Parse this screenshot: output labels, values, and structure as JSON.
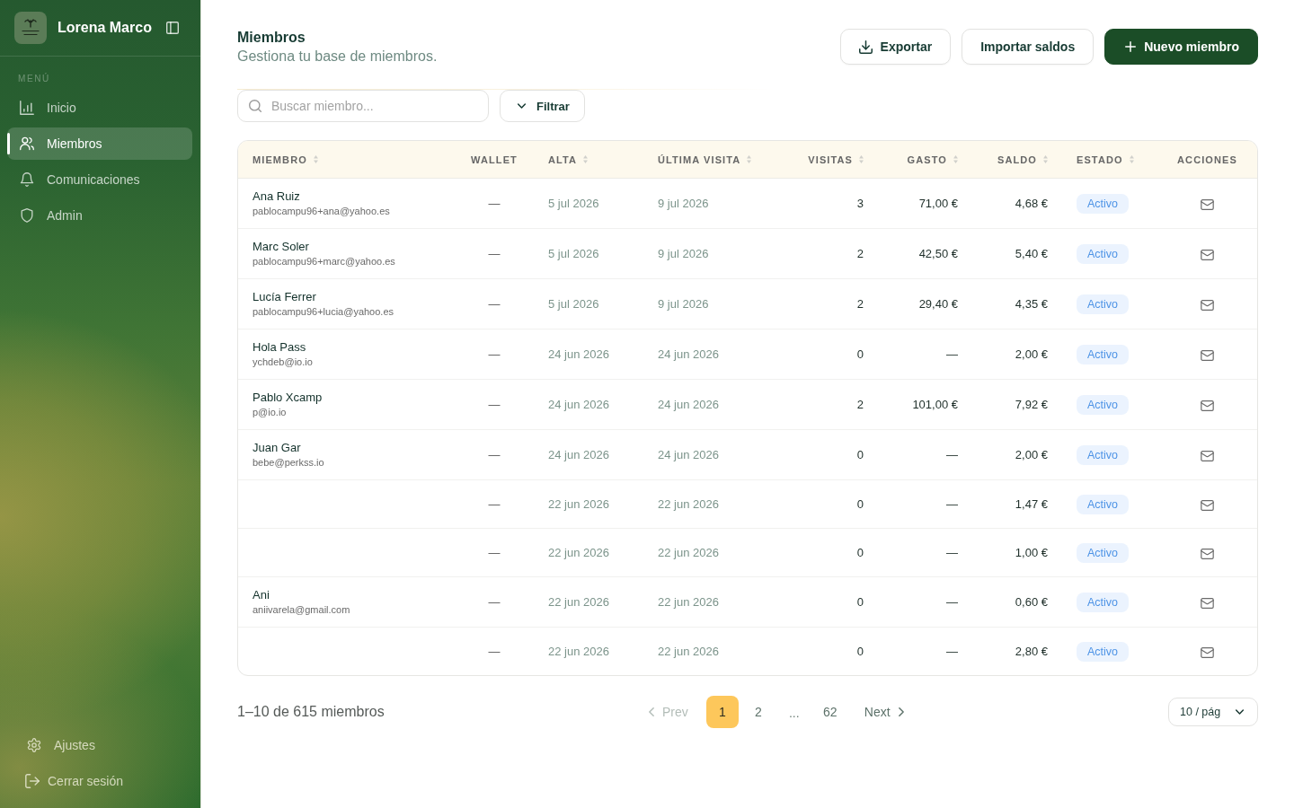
{
  "sidebar": {
    "brand": "Lorena Marco",
    "section_label": "MENÚ",
    "items": [
      {
        "label": "Inicio",
        "selected": false
      },
      {
        "label": "Miembros",
        "selected": true
      },
      {
        "label": "Comunicaciones",
        "selected": false
      },
      {
        "label": "Admin",
        "selected": false
      }
    ],
    "footer_items": [
      {
        "label": "Ajustes"
      },
      {
        "label": "Cerrar sesión"
      }
    ]
  },
  "header": {
    "title": "Miembros",
    "subtitle": "Gestiona tu base de miembros.",
    "buttons": [
      {
        "label": "Exportar",
        "kind": "export"
      },
      {
        "label": "Importar saldos",
        "kind": "plain"
      },
      {
        "label": "Nuevo miembro",
        "kind": "primary"
      }
    ]
  },
  "toolbar": {
    "search": {
      "placeholder": "Buscar miembro..."
    },
    "filter": {
      "label": "Filtrar"
    }
  },
  "table": {
    "columns": [
      {
        "label": "MIEMBRO",
        "sortable": true
      },
      {
        "label": "WALLET",
        "sortable": false
      },
      {
        "label": "ALTA",
        "sortable": true
      },
      {
        "label": "ÚLTIMA VISITA",
        "sortable": true
      },
      {
        "label": "VISITAS",
        "sortable": true
      },
      {
        "label": "GASTO",
        "sortable": true
      },
      {
        "label": "SALDO",
        "sortable": true
      },
      {
        "label": "ESTADO",
        "sortable": true
      },
      {
        "label": "ACCIONES",
        "sortable": false
      }
    ],
    "rows": [
      {
        "name": "Ana Ruiz",
        "email": "pablocampu96+ana@yahoo.es",
        "wallet": "—",
        "alta": "5 jul 2026",
        "ultima_visita": "9 jul 2026",
        "visitas": "3",
        "gasto": "71,00 €",
        "saldo": "4,68 €",
        "estado": "Activo"
      },
      {
        "name": "Marc Soler",
        "email": "pablocampu96+marc@yahoo.es",
        "wallet": "—",
        "alta": "5 jul 2026",
        "ultima_visita": "9 jul 2026",
        "visitas": "2",
        "gasto": "42,50 €",
        "saldo": "5,40 €",
        "estado": "Activo"
      },
      {
        "name": "Lucía Ferrer",
        "email": "pablocampu96+lucia@yahoo.es",
        "wallet": "—",
        "alta": "5 jul 2026",
        "ultima_visita": "9 jul 2026",
        "visitas": "2",
        "gasto": "29,40 €",
        "saldo": "4,35 €",
        "estado": "Activo"
      },
      {
        "name": "Hola Pass",
        "email": "ychdeb@io.io",
        "wallet": "—",
        "alta": "24 jun 2026",
        "ultima_visita": "24 jun 2026",
        "visitas": "0",
        "gasto": "—",
        "saldo": "2,00 €",
        "estado": "Activo"
      },
      {
        "name": "Pablo Xcamp",
        "email": "p@io.io",
        "wallet": "—",
        "alta": "24 jun 2026",
        "ultima_visita": "24 jun 2026",
        "visitas": "2",
        "gasto": "101,00 €",
        "saldo": "7,92 €",
        "estado": "Activo"
      },
      {
        "name": "Juan Gar",
        "email": "bebe@perkss.io",
        "wallet": "—",
        "alta": "24 jun 2026",
        "ultima_visita": "24 jun 2026",
        "visitas": "0",
        "gasto": "—",
        "saldo": "2,00 €",
        "estado": "Activo"
      },
      {
        "wallet": "—",
        "alta": "22 jun 2026",
        "ultima_visita": "22 jun 2026",
        "visitas": "0",
        "gasto": "—",
        "saldo": "1,47 €",
        "estado": "Activo"
      },
      {
        "wallet": "—",
        "alta": "22 jun 2026",
        "ultima_visita": "22 jun 2026",
        "visitas": "0",
        "gasto": "—",
        "saldo": "1,00 €",
        "estado": "Activo"
      },
      {
        "name": "Ani",
        "email": "aniivarela@gmail.com",
        "wallet": "—",
        "alta": "22 jun 2026",
        "ultima_visita": "22 jun 2026",
        "visitas": "0",
        "gasto": "—",
        "saldo": "0,60 €",
        "estado": "Activo"
      },
      {
        "wallet": "—",
        "alta": "22 jun 2026",
        "ultima_visita": "22 jun 2026",
        "visitas": "0",
        "gasto": "—",
        "saldo": "2,80 €",
        "estado": "Activo"
      }
    ]
  },
  "pagination": {
    "summary": "1–10 de 615 miembros",
    "prev": {
      "label": "Prev",
      "disabled": true
    },
    "pages": [
      {
        "label": "1",
        "kind": "page",
        "selected": true
      },
      {
        "label": "2",
        "kind": "page",
        "selected": false
      },
      {
        "label": "...",
        "kind": "ellipsis",
        "selected": false
      },
      {
        "label": "62",
        "kind": "page",
        "selected": false
      }
    ],
    "next": {
      "label": "Next",
      "disabled": false
    },
    "page_size": {
      "value": "10 / pág"
    }
  }
}
